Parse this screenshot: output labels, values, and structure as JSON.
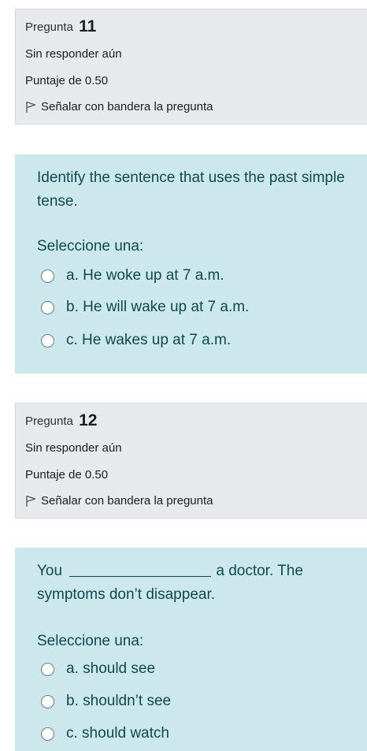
{
  "questions": [
    {
      "label": "Pregunta",
      "number": "11",
      "status": "Sin responder aún",
      "score": "Puntaje de 0.50",
      "flag_label": "Señalar con bandera la pregunta",
      "text": "Identify the sentence that uses the past simple tense.",
      "prompt": "Seleccione una:",
      "options": [
        "a. He woke up at 7 a.m.",
        "b. He will wake up at 7 a.m.",
        "c. He wakes up at 7 a.m."
      ]
    },
    {
      "label": "Pregunta",
      "number": "12",
      "status": "Sin responder aún",
      "score": "Puntaje de 0.50",
      "flag_label": "Señalar con bandera la pregunta",
      "text_before": "You",
      "text_after": "a doctor. The symptoms don’t disappear.",
      "prompt": "Seleccione una:",
      "options": [
        "a. should see",
        "b. shouldn’t see",
        "c. should watch"
      ]
    }
  ]
}
